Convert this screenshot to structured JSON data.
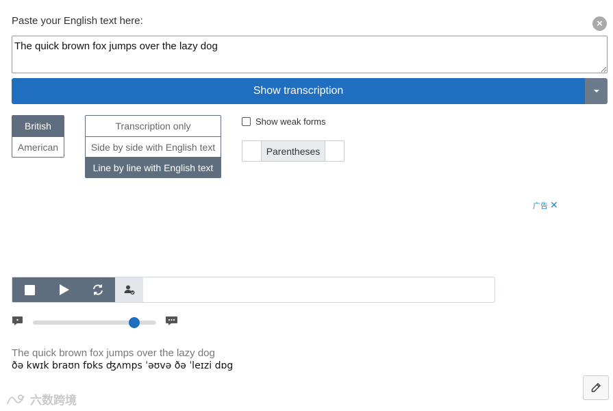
{
  "prompt": {
    "label": "Paste your English text here:"
  },
  "input": {
    "value": "The quick brown fox jumps over the lazy dog"
  },
  "show_button": {
    "label": "Show transcription"
  },
  "accent": {
    "options": [
      "British",
      "American"
    ],
    "selected": "British"
  },
  "mode": {
    "options": [
      "Transcription only",
      "Side by side with English text",
      "Line by line with English text"
    ],
    "selected": "Line by line with English text"
  },
  "weak_forms": {
    "label": "Show weak forms",
    "checked": false
  },
  "parentheses": {
    "label": "Parentheses"
  },
  "ad": {
    "label": "广告"
  },
  "speed": {
    "level": 0.82
  },
  "output": {
    "words": [
      "The quick brown fox ",
      "jumps ",
      "over ",
      "the lazy ",
      "dog"
    ],
    "ipa": [
      "ðə ",
      "kwɪk ",
      "braʊn ",
      "fɒks ",
      "ʤʌmps ",
      "ˈəʊvə ",
      "ðə ",
      "ˈleɪzi ",
      "dɒg"
    ]
  },
  "watermark": {
    "text": "六数跨境"
  },
  "colors": {
    "accent": "#1f6ec0",
    "slate": "#5f6e7e"
  }
}
